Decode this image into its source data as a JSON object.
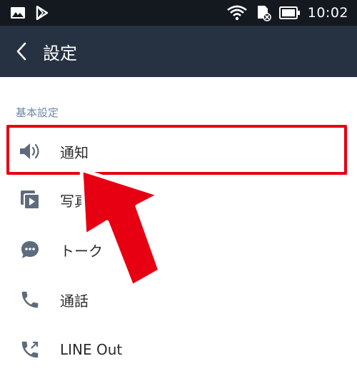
{
  "status_bar": {
    "time": "10:02",
    "left_icons": [
      "gallery-icon",
      "play-store-icon"
    ],
    "right_icons": [
      "wifi-icon",
      "sd-card-icon",
      "battery-icon"
    ]
  },
  "header": {
    "back_icon": "chevron-left-icon",
    "title": "設定"
  },
  "section": {
    "label": "基本設定"
  },
  "items": [
    {
      "label": "通知",
      "icon": "speaker-icon"
    },
    {
      "label": "写真と動画",
      "icon": "photo-video-icon"
    },
    {
      "label": "トーク",
      "icon": "chat-bubble-icon"
    },
    {
      "label": "通話",
      "icon": "phone-icon"
    },
    {
      "label": "LINE Out",
      "icon": "phone-out-icon"
    }
  ],
  "colors": {
    "status_bar": "#14181f",
    "header": "#263142",
    "section_label": "#6e89a8",
    "highlight": "#e60012",
    "icon": "#5d6b7d"
  }
}
